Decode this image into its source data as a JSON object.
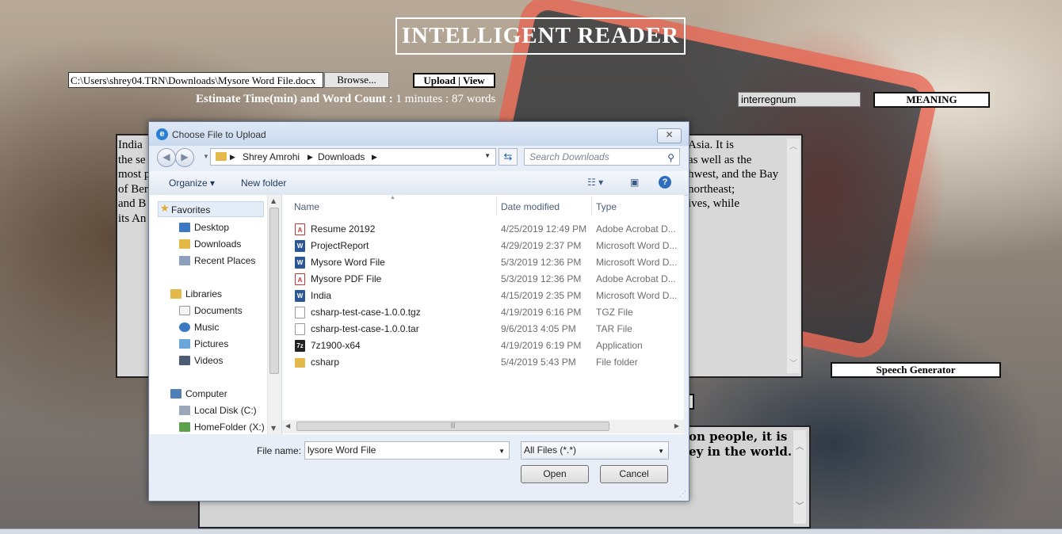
{
  "app": {
    "title": "INTELLIGENT READER",
    "file_path": "C:\\Users\\shrey04.TRN\\Downloads\\Mysore Word File.docx",
    "browse_label": "Browse...",
    "upload_view_label": "Upload | View",
    "estimate_label": "Estimate Time(min) and Word Count :",
    "estimate_value": "1 minutes : 87 words",
    "word_input_value": "interregnum",
    "meaning_label": "MEANING",
    "speech_label": "Speech Generator",
    "main_text_left": [
      "India",
      "the se",
      "most p",
      "of Ber",
      "and B",
      "its An"
    ],
    "main_text_right": [
      "Asia. It is",
      "as well as the",
      "hwest, and the Bay",
      "northeast;",
      "ives, while"
    ],
    "output_text": [
      "on people, it is",
      "ey in the world."
    ]
  },
  "dialog": {
    "title": "Choose File to Upload",
    "close_label": "✕",
    "breadcrumb": [
      "Shrey Amrohi",
      "Downloads"
    ],
    "search_placeholder": "Search Downloads",
    "toolbar": {
      "organize": "Organize ▾",
      "new_folder": "New folder"
    },
    "nav_pane": {
      "favorites": "Favorites",
      "fav_items": [
        "Desktop",
        "Downloads",
        "Recent Places"
      ],
      "libraries": "Libraries",
      "lib_items": [
        "Documents",
        "Music",
        "Pictures",
        "Videos"
      ],
      "computer": "Computer",
      "comp_items": [
        "Local Disk (C:)",
        "HomeFolder (X:)"
      ]
    },
    "columns": {
      "name": "Name",
      "date": "Date modified",
      "type": "Type"
    },
    "files": [
      {
        "name": "Resume 20192",
        "date": "4/25/2019 12:49 PM",
        "type": "Adobe Acrobat D...",
        "icon": "pdf-icon"
      },
      {
        "name": "ProjectReport",
        "date": "4/29/2019 2:37 PM",
        "type": "Microsoft Word D...",
        "icon": "word-icon"
      },
      {
        "name": "Mysore Word File",
        "date": "5/3/2019 12:36 PM",
        "type": "Microsoft Word D...",
        "icon": "word-icon"
      },
      {
        "name": "Mysore PDF File",
        "date": "5/3/2019 12:36 PM",
        "type": "Adobe Acrobat D...",
        "icon": "pdf-icon"
      },
      {
        "name": "India",
        "date": "4/15/2019 2:35 PM",
        "type": "Microsoft Word D...",
        "icon": "word-icon"
      },
      {
        "name": "csharp-test-case-1.0.0.tgz",
        "date": "4/19/2019 6:16 PM",
        "type": "TGZ File",
        "icon": "file-icon"
      },
      {
        "name": "csharp-test-case-1.0.0.tar",
        "date": "9/6/2013 4:05 PM",
        "type": "TAR File",
        "icon": "file-icon"
      },
      {
        "name": "7z1900-x64",
        "date": "4/19/2019 6:19 PM",
        "type": "Application",
        "icon": "7zip-icon"
      },
      {
        "name": "csharp",
        "date": "5/4/2019 5:43 PM",
        "type": "File folder",
        "icon": "folder-icon"
      }
    ],
    "file_name_label": "File name:",
    "file_name_value": "lysore Word File",
    "filter_value": "All Files (*.*)",
    "open_label": "Open",
    "cancel_label": "Cancel"
  }
}
